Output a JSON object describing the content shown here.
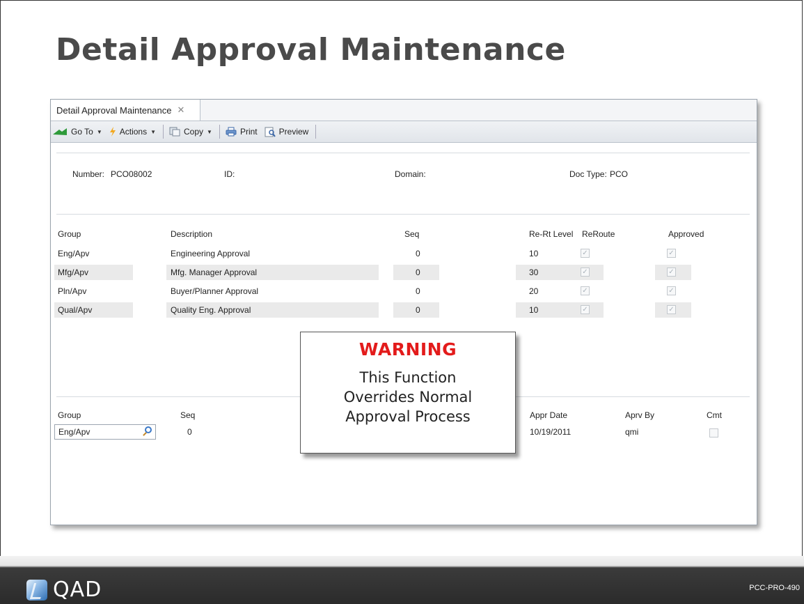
{
  "slide": {
    "title": "Detail Approval Maintenance",
    "footer_code": "PCC-PRO-490",
    "logo_text": "QAD"
  },
  "tab": {
    "label": "Detail Approval Maintenance",
    "close": "✕"
  },
  "toolbar": {
    "goto": "Go To",
    "actions": "Actions",
    "copy": "Copy",
    "print": "Print",
    "preview": "Preview"
  },
  "header": {
    "number_label": "Number:",
    "number_value": "PCO08002",
    "id_label": "ID:",
    "domain_label": "Domain:",
    "doctype_label": "Doc Type:",
    "doctype_value": "PCO"
  },
  "grid": {
    "columns": {
      "group": "Group",
      "description": "Description",
      "seq": "Seq",
      "rert": "Re-Rt Level",
      "reroute": "ReRoute",
      "approved": "Approved"
    },
    "rows": [
      {
        "group": "Eng/Apv",
        "description": "Engineering Approval",
        "seq": "0",
        "rert": "10",
        "reroute": true,
        "approved": true
      },
      {
        "group": "Mfg/Apv",
        "description": "Mfg. Manager Approval",
        "seq": "0",
        "rert": "30",
        "reroute": true,
        "approved": true
      },
      {
        "group": "Pln/Apv",
        "description": "Buyer/Planner Approval",
        "seq": "0",
        "rert": "20",
        "reroute": true,
        "approved": true
      },
      {
        "group": "Qual/Apv",
        "description": "Quality Eng. Approval",
        "seq": "0",
        "rert": "10",
        "reroute": true,
        "approved": true
      }
    ]
  },
  "detail": {
    "group_label": "Group",
    "group_value": "Eng/Apv",
    "seq_label": "Seq",
    "seq_value": "0",
    "appr_date_label": "Appr Date",
    "appr_date_value": "10/19/2011",
    "aprv_by_label": "Aprv By",
    "aprv_by_value": "qmi",
    "cmt_label": "Cmt",
    "cmt_checked": false
  },
  "warning": {
    "title": "WARNING",
    "text": "This Function\nOverrides Normal\nApproval Process"
  },
  "colors": {
    "warning_red": "#e31b1b",
    "title_gray": "#4a4a4a"
  }
}
